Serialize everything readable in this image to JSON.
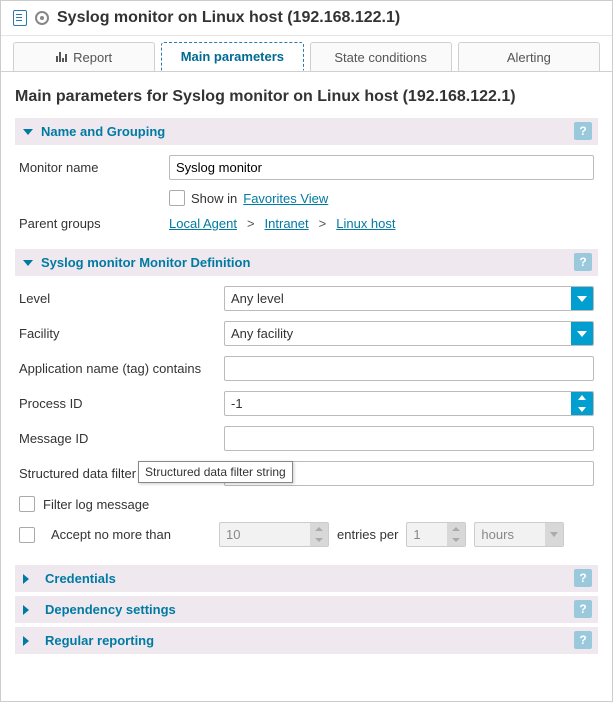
{
  "header": {
    "title": "Syslog monitor on Linux host (192.168.122.1)"
  },
  "tabs": {
    "report": "Report",
    "main_params": "Main parameters",
    "state_conditions": "State conditions",
    "alerting": "Alerting"
  },
  "page": {
    "heading": "Main parameters for Syslog monitor on Linux host (192.168.122.1)"
  },
  "sections": {
    "name_grouping": {
      "title": "Name and Grouping",
      "monitor_name_label": "Monitor name",
      "monitor_name_value": "Syslog monitor",
      "show_in_label": "Show in",
      "favorites_link": "Favorites View",
      "parent_groups_label": "Parent groups",
      "parent_path": [
        "Local Agent",
        "Intranet",
        "Linux host"
      ]
    },
    "monitor_def": {
      "title": "Syslog monitor Monitor Definition",
      "level_label": "Level",
      "level_value": "Any level",
      "facility_label": "Facility",
      "facility_value": "Any facility",
      "appname_label": "Application name (tag) contains",
      "appname_value": "",
      "procid_label": "Process ID",
      "procid_value": "-1",
      "msgid_label": "Message ID",
      "msgid_value": "",
      "structdata_label": "Structured data filter",
      "structdata_value": "",
      "filter_log_label": "Filter log message",
      "accept_no_more_label": "Accept no more than",
      "accept_count": "10",
      "entries_per_label": "entries per",
      "interval_value": "1",
      "interval_unit": "hours",
      "tooltip": "Structured data filter string"
    },
    "credentials": {
      "title": "Credentials"
    },
    "dependency": {
      "title": "Dependency settings"
    },
    "reporting": {
      "title": "Regular reporting"
    }
  }
}
